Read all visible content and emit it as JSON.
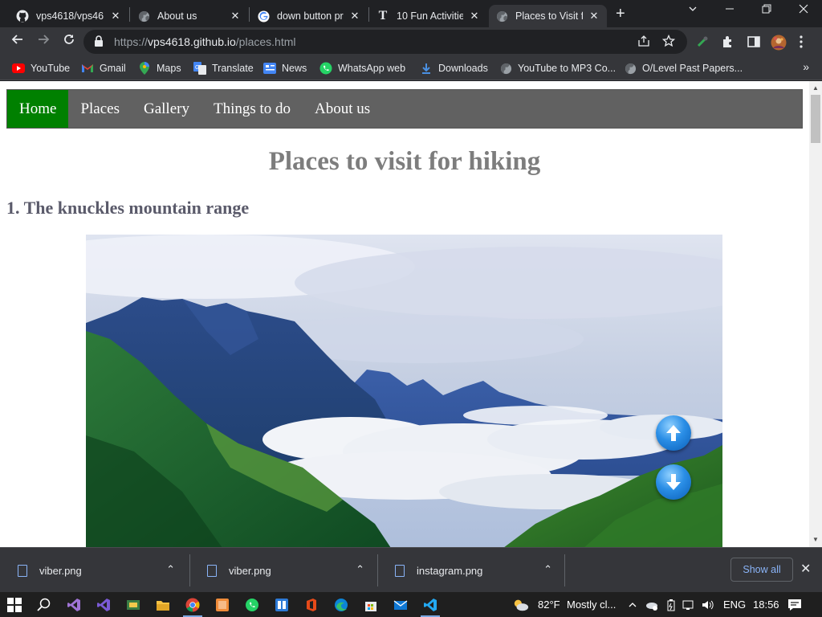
{
  "browser": {
    "tabs": [
      {
        "title": "vps4618/vps461",
        "icon": "github-icon",
        "active": false
      },
      {
        "title": "About us",
        "icon": "globe-icon",
        "active": false
      },
      {
        "title": "down button pr",
        "icon": "google-icon",
        "active": false
      },
      {
        "title": "10 Fun Activitie",
        "icon": "site-t-icon",
        "active": false
      },
      {
        "title": "Places to Visit fo",
        "icon": "globe-icon",
        "active": true
      }
    ],
    "new_tab_symbol": "+",
    "address": {
      "scheme": "https://",
      "host": "vps4618.github.io",
      "path": "/places.html"
    },
    "bookmarks": [
      {
        "label": "YouTube",
        "icon": "youtube-icon"
      },
      {
        "label": "Gmail",
        "icon": "gmail-icon"
      },
      {
        "label": "Maps",
        "icon": "maps-icon"
      },
      {
        "label": "Translate",
        "icon": "translate-icon"
      },
      {
        "label": "News",
        "icon": "news-icon"
      },
      {
        "label": "WhatsApp web",
        "icon": "whatsapp-icon"
      },
      {
        "label": "Downloads",
        "icon": "download-icon"
      },
      {
        "label": "YouTube to MP3 Co...",
        "icon": "globe-icon"
      },
      {
        "label": "O/Level Past Papers...",
        "icon": "globe-icon"
      }
    ],
    "bookmarks_overflow": "»"
  },
  "page": {
    "nav": [
      {
        "label": "Home",
        "active": true
      },
      {
        "label": "Places",
        "active": false
      },
      {
        "label": "Gallery",
        "active": false
      },
      {
        "label": "Things to do",
        "active": false
      },
      {
        "label": "About us",
        "active": false
      }
    ],
    "heading": "Places to visit for hiking",
    "section_heading": "1. The knuckles mountain range",
    "nav_active_color": "#008000",
    "nav_bar_color": "#616161"
  },
  "downloads": {
    "items": [
      {
        "filename": "viber.png"
      },
      {
        "filename": "viber.png"
      },
      {
        "filename": "instagram.png"
      }
    ],
    "show_all_label": "Show all"
  },
  "taskbar": {
    "weather_temp": "82°F",
    "weather_text": "Mostly cl...",
    "language": "ENG",
    "time": "18:56"
  }
}
